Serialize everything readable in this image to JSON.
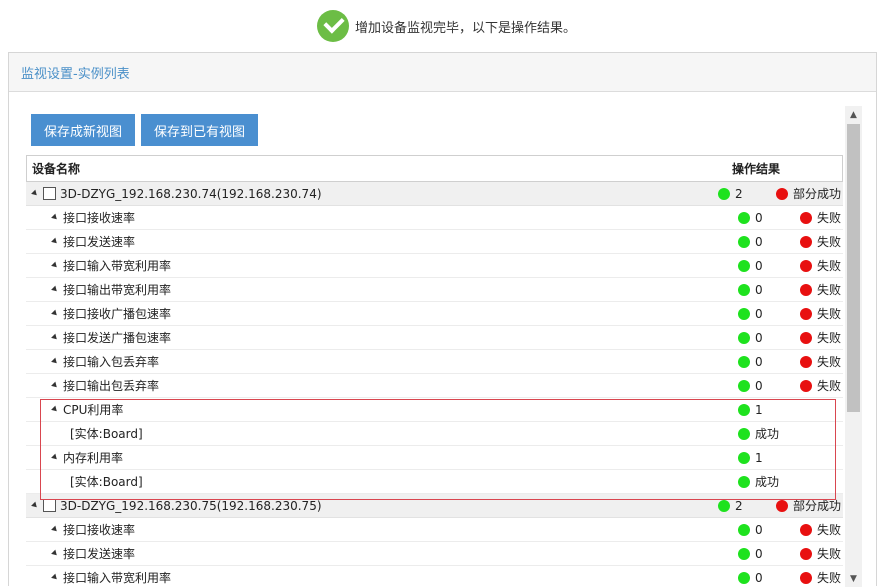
{
  "banner": {
    "message": "增加设备监视完毕，以下是操作结果。"
  },
  "panel": {
    "title": "监视设置-实例列表"
  },
  "buttons": {
    "save_new": "保存成新视图",
    "save_existing": "保存到已有视图"
  },
  "table": {
    "col_name": "设备名称",
    "col_result": "操作结果",
    "rows": [
      {
        "type": "device",
        "name": "3D-DZYG_192.168.230.74(192.168.230.74)",
        "count": "2",
        "status": "部分成功",
        "status_color": "red"
      },
      {
        "type": "metric",
        "name": "接口接收速率",
        "count": "0",
        "status": "失败",
        "status_color": "red"
      },
      {
        "type": "metric",
        "name": "接口发送速率",
        "count": "0",
        "status": "失败",
        "status_color": "red"
      },
      {
        "type": "metric",
        "name": "接口输入带宽利用率",
        "count": "0",
        "status": "失败",
        "status_color": "red"
      },
      {
        "type": "metric",
        "name": "接口输出带宽利用率",
        "count": "0",
        "status": "失败",
        "status_color": "red"
      },
      {
        "type": "metric",
        "name": "接口接收广播包速率",
        "count": "0",
        "status": "失败",
        "status_color": "red"
      },
      {
        "type": "metric",
        "name": "接口发送广播包速率",
        "count": "0",
        "status": "失败",
        "status_color": "red"
      },
      {
        "type": "metric",
        "name": "接口输入包丢弃率",
        "count": "0",
        "status": "失败",
        "status_color": "red"
      },
      {
        "type": "metric",
        "name": "接口输出包丢弃率",
        "count": "0",
        "status": "失败",
        "status_color": "red"
      },
      {
        "type": "metric",
        "name": "CPU利用率",
        "count": "1",
        "status": "",
        "status_color": ""
      },
      {
        "type": "instance",
        "name": "[实体:Board]",
        "count": "",
        "status": "成功",
        "status_color": "green"
      },
      {
        "type": "metric",
        "name": "内存利用率",
        "count": "1",
        "status": "",
        "status_color": ""
      },
      {
        "type": "instance",
        "name": "[实体:Board]",
        "count": "",
        "status": "成功",
        "status_color": "green"
      },
      {
        "type": "device",
        "name": "3D-DZYG_192.168.230.75(192.168.230.75)",
        "count": "2",
        "status": "部分成功",
        "status_color": "red"
      },
      {
        "type": "metric",
        "name": "接口接收速率",
        "count": "0",
        "status": "失败",
        "status_color": "red"
      },
      {
        "type": "metric",
        "name": "接口发送速率",
        "count": "0",
        "status": "失败",
        "status_color": "red"
      },
      {
        "type": "metric",
        "name": "接口输入带宽利用率",
        "count": "0",
        "status": "失败",
        "status_color": "red"
      }
    ]
  },
  "colors": {
    "accent": "#4a8fd0",
    "success": "#1ee21e",
    "fail": "#e81010",
    "highlight_border": "#d9464f"
  }
}
